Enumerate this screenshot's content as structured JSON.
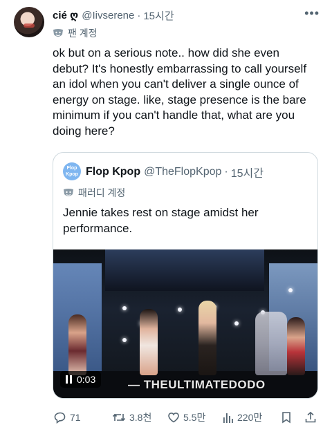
{
  "tweet": {
    "display_name": "cié ღ",
    "handle": "@Iivserene",
    "separator": "·",
    "time": "15시간",
    "account_label": "팬 계정",
    "text": "ok but on a serious note.. how did she even debut? It's honestly embarrassing to call yourself an idol when you can't deliver a single ounce of energy on stage. like, stage presence is the bare minimum if you can't handle that, what are you doing here?"
  },
  "quoted": {
    "avatar_text_1": "Flop",
    "avatar_text_2": "Kpop",
    "display_name": "Flop Kpop",
    "handle": "@TheFlopKpop",
    "separator": "·",
    "time": "15시간",
    "account_label": "패러디 계정",
    "text": "Jennie takes rest on stage amidst her performance.",
    "video": {
      "timestamp": "0:03",
      "watermark": "— THEULTIMATEDODO"
    }
  },
  "actions": {
    "replies": "71",
    "reposts": "3.8천",
    "likes": "5.5만",
    "views": "220만"
  },
  "colors": {
    "text": "#0f1419",
    "secondary": "#536471",
    "border": "#cfd9de"
  }
}
